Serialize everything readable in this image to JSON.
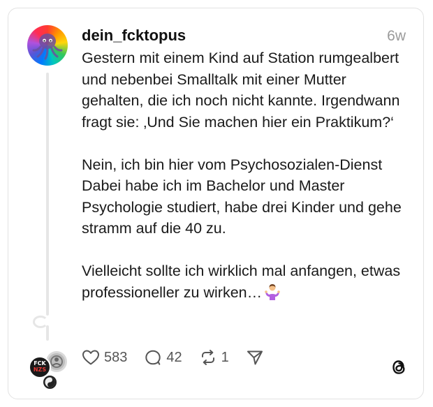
{
  "post": {
    "username": "dein_fcktopus",
    "time": "6w",
    "paragraphs": [
      "Gestern mit einem Kind auf Station rumgealbert und nebenbei Smalltalk mit einer Mutter gehalten, die ich noch nicht kannte. Irgendwann fragt sie: ‚Und Sie machen hier ein Praktikum?‘",
      "Nein, ich bin hier vom Psychosozialen-Dienst Dabei habe ich im Bachelor und Master Psychologie studiert, habe drei Kinder und gehe stramm auf die 40 zu.",
      "Vielleicht sollte ich wirklich mal anfangen, etwas professioneller zu wirken…"
    ],
    "trailing_emoji": "person-shrugging-emoji"
  },
  "actions": {
    "likes": "583",
    "replies": "42",
    "reposts": "1"
  },
  "mini_avatars": {
    "first_text_top": "FCK",
    "first_text_bottom": "NZS"
  },
  "icons": {
    "like": "heart-icon",
    "reply": "comment-bubble-icon",
    "repost": "repost-arrows-icon",
    "share": "send-icon",
    "brand": "threads-logo-icon"
  },
  "colors": {
    "border": "#e2e2e2",
    "muted": "#9a9a9a",
    "text": "#111111",
    "thread_line": "#e6e6e6"
  }
}
